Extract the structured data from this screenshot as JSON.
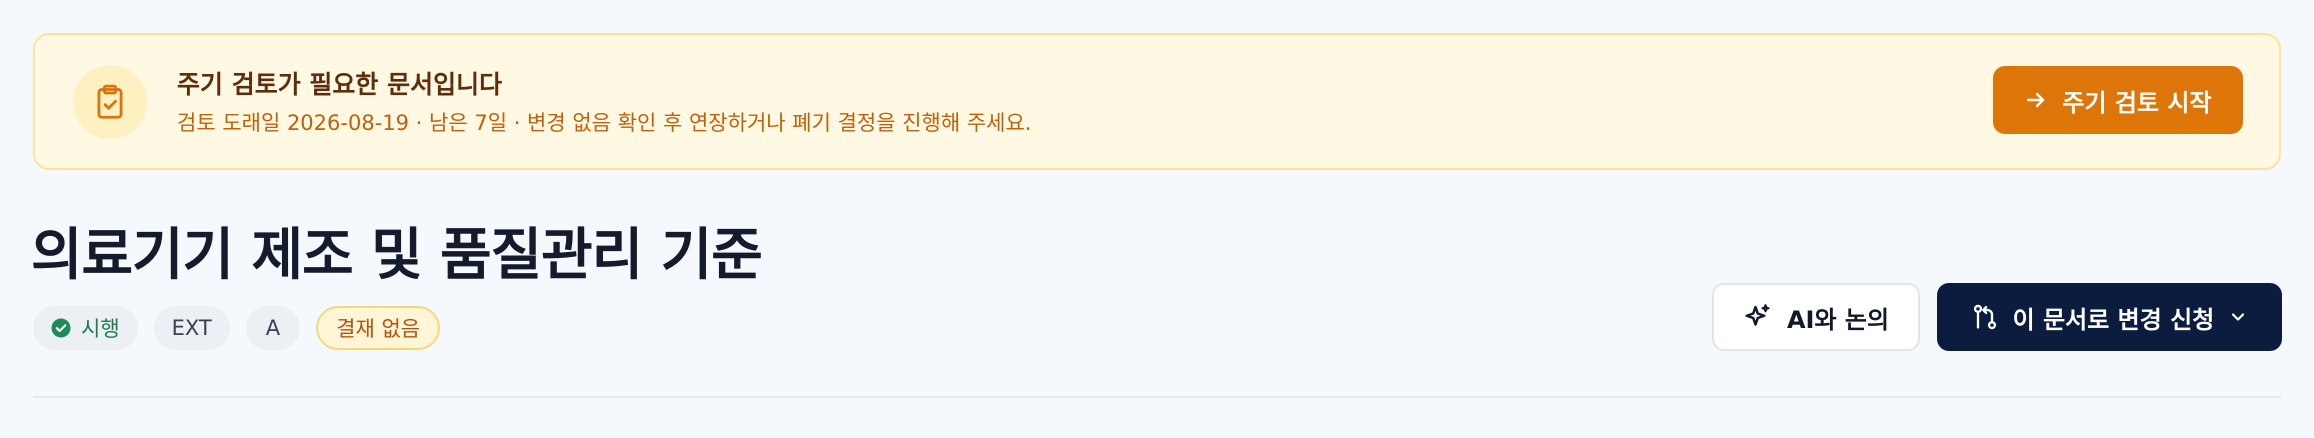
{
  "banner": {
    "icon": "clipboard-check-icon",
    "title": "주기 검토가 필요한 문서입니다",
    "subtitle": "검토 도래일 2026-08-19 · 남은 7일 · 변경 없음 확인 후 연장하거나 폐기 결정을 진행해 주세요.",
    "button_label": "주기 검토 시작",
    "button_icon": "arrow-right-icon",
    "colors": {
      "background": "#fff9e4",
      "border": "#fbe49a",
      "accent": "#de7508",
      "title": "#5e2e0c",
      "subtitle": "#c0600a"
    }
  },
  "document": {
    "title": "의료기기 제조 및 품질관리 기준",
    "badges": {
      "status": "시행",
      "status_icon": "check-circle-icon",
      "scope": "EXT",
      "grade": "A",
      "approval": "결재 없음"
    }
  },
  "actions": {
    "ai_label": "AI와 논의",
    "ai_icon": "sparkles-icon",
    "change_label": "이 문서로 변경 신청",
    "change_icon": "git-pull-request-icon",
    "change_dropdown_icon": "chevron-down-icon",
    "colors": {
      "primary": "#0c1c3f",
      "status_green": "#1f8a5a"
    }
  }
}
